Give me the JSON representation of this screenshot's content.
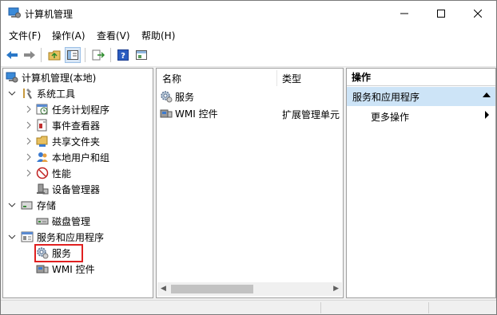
{
  "window": {
    "title": "计算机管理"
  },
  "menu": [
    "文件(F)",
    "操作(A)",
    "查看(V)",
    "帮助(H)"
  ],
  "toolbar": {
    "icons": [
      "back-arrow-icon",
      "forward-arrow-icon",
      "folder-up-icon",
      "show-hide-tree-icon",
      "export-list-icon",
      "help-icon",
      "properties-icon"
    ]
  },
  "tree": {
    "root": "计算机管理(本地)",
    "system_tools": "系统工具",
    "task_scheduler": "任务计划程序",
    "event_viewer": "事件查看器",
    "shared_folders": "共享文件夹",
    "local_users": "本地用户和组",
    "performance": "性能",
    "device_manager": "设备管理器",
    "storage": "存储",
    "disk_management": "磁盘管理",
    "services_apps": "服务和应用程序",
    "services": "服务",
    "wmi": "WMI 控件"
  },
  "list": {
    "columns": [
      "名称",
      "类型"
    ],
    "rows": [
      {
        "name": "服务",
        "type": ""
      },
      {
        "name": "WMI 控件",
        "type": "扩展管理单元"
      }
    ]
  },
  "actions": {
    "header": "操作",
    "section": "服务和应用程序",
    "more": "更多操作"
  },
  "colors": {
    "selection": "#cde4f7",
    "highlight_box": "#e02020",
    "accent": "#0078d7"
  }
}
